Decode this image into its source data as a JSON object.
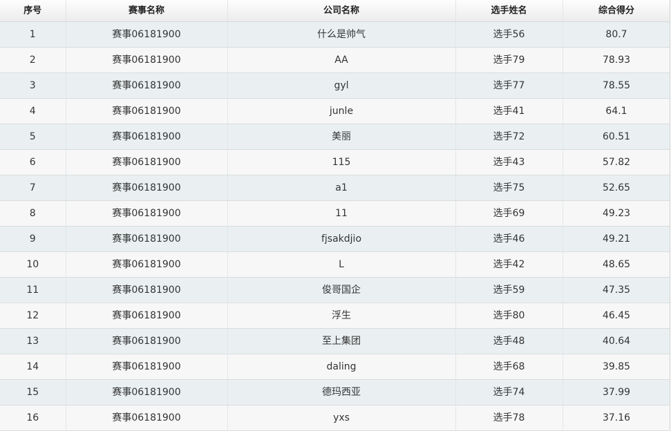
{
  "table": {
    "headers": [
      "序号",
      "赛事名称",
      "公司名称",
      "选手姓名",
      "综合得分"
    ],
    "rows": [
      [
        "1",
        "赛事06181900",
        "什么是帅气",
        "选手56",
        "80.7"
      ],
      [
        "2",
        "赛事06181900",
        "AA",
        "选手79",
        "78.93"
      ],
      [
        "3",
        "赛事06181900",
        "gyl",
        "选手77",
        "78.55"
      ],
      [
        "4",
        "赛事06181900",
        "junle",
        "选手41",
        "64.1"
      ],
      [
        "5",
        "赛事06181900",
        "美丽",
        "选手72",
        "60.51"
      ],
      [
        "6",
        "赛事06181900",
        "115",
        "选手43",
        "57.82"
      ],
      [
        "7",
        "赛事06181900",
        "a1",
        "选手75",
        "52.65"
      ],
      [
        "8",
        "赛事06181900",
        "11",
        "选手69",
        "49.23"
      ],
      [
        "9",
        "赛事06181900",
        "fjsakdjio",
        "选手46",
        "49.21"
      ],
      [
        "10",
        "赛事06181900",
        "L",
        "选手42",
        "48.65"
      ],
      [
        "11",
        "赛事06181900",
        "俊哥国企",
        "选手59",
        "47.35"
      ],
      [
        "12",
        "赛事06181900",
        "浮生",
        "选手80",
        "46.45"
      ],
      [
        "13",
        "赛事06181900",
        "至上集团",
        "选手48",
        "40.64"
      ],
      [
        "14",
        "赛事06181900",
        "daling",
        "选手68",
        "39.85"
      ],
      [
        "15",
        "赛事06181900",
        "德玛西亚",
        "选手74",
        "37.99"
      ],
      [
        "16",
        "赛事06181900",
        "yxs",
        "选手78",
        "37.16"
      ]
    ]
  },
  "colors": {
    "row_odd": "#eaf0f2",
    "row_even": "#f7f7f7",
    "header_bg": "#ececec",
    "text": "#333333"
  }
}
